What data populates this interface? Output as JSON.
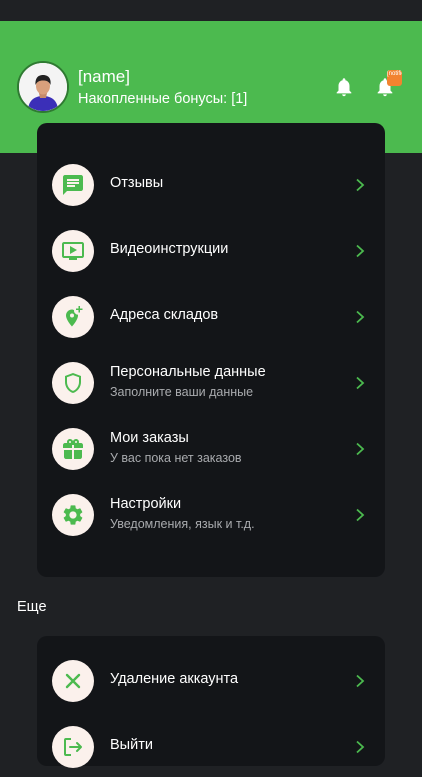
{
  "header": {
    "user_name": "[name]",
    "bonus_text": "Накопленные бонусы: [1]",
    "notification_badge": "[notification]",
    "accent_color": "#4cba4f"
  },
  "menu": {
    "items": [
      {
        "title": "Отзывы",
        "subtitle": "",
        "icon": "chat-icon"
      },
      {
        "title": "Видеоинструкции",
        "subtitle": "",
        "icon": "video-icon"
      },
      {
        "title": "Адреса складов",
        "subtitle": "",
        "icon": "add-location-icon"
      },
      {
        "title": "Персональные данные",
        "subtitle": "Заполните ваши данные",
        "icon": "shield-icon"
      },
      {
        "title": "Мои заказы",
        "subtitle": "У вас пока нет заказов",
        "icon": "gift-icon"
      },
      {
        "title": "Настройки",
        "subtitle": "Уведомления, язык и т.д.",
        "icon": "gear-icon"
      }
    ]
  },
  "more": {
    "section_title": "Еще",
    "items": [
      {
        "title": "Удаление аккаунта",
        "icon": "close-icon"
      },
      {
        "title": "Выйти",
        "icon": "logout-icon"
      }
    ]
  }
}
